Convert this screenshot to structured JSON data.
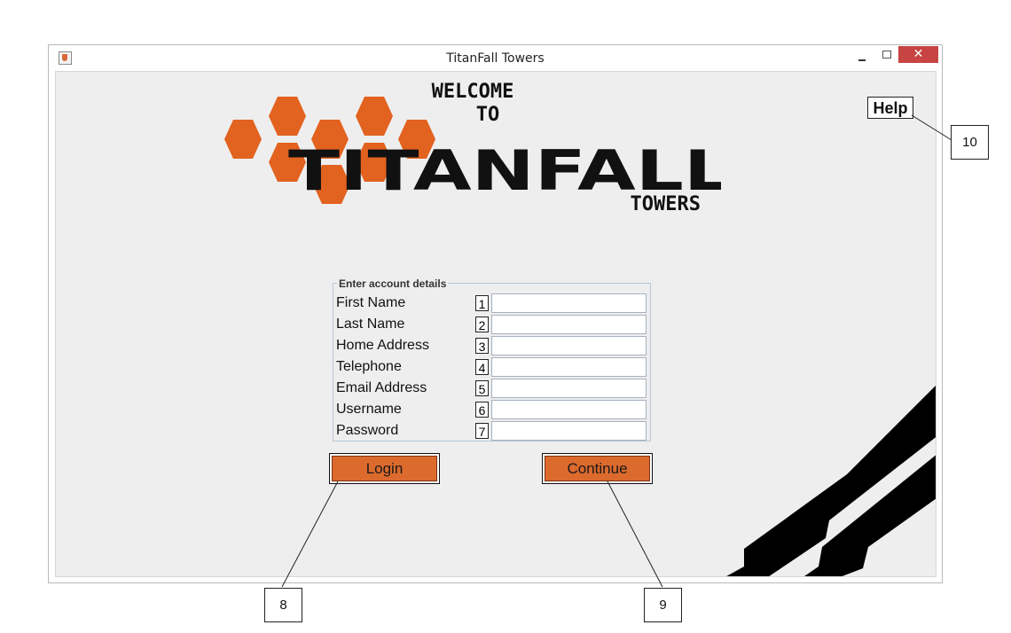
{
  "window": {
    "title": "TitanFall Towers",
    "close_glyph": "✕"
  },
  "logo": {
    "line1": "WELCOME",
    "line2": "TO",
    "brand": "TITANFALL",
    "subbrand": "TOWERS",
    "hex_color": "#e2621f"
  },
  "help": {
    "label": "Help"
  },
  "form": {
    "legend": "Enter account details",
    "fields": [
      {
        "label": "First Name",
        "number": "1",
        "value": ""
      },
      {
        "label": "Last Name",
        "number": "2",
        "value": ""
      },
      {
        "label": "Home Address",
        "number": "3",
        "value": ""
      },
      {
        "label": "Telephone",
        "number": "4",
        "value": ""
      },
      {
        "label": "Email Address",
        "number": "5",
        "value": ""
      },
      {
        "label": "Username",
        "number": "6",
        "value": ""
      },
      {
        "label": "Password",
        "number": "7",
        "value": ""
      }
    ]
  },
  "buttons": {
    "login": "Login",
    "continue": "Continue",
    "accent": "#dd6a2d"
  },
  "callouts": {
    "login": "8",
    "continue": "9",
    "help": "10"
  }
}
